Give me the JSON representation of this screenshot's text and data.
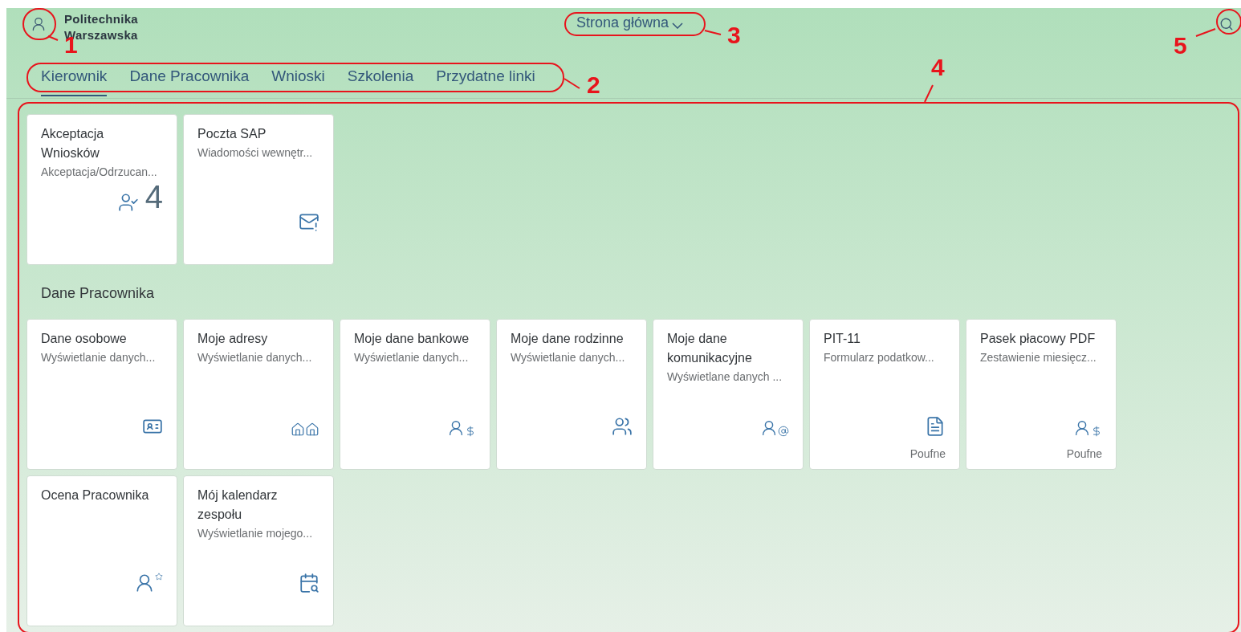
{
  "header": {
    "logo_lines": [
      "Politechnika",
      "Warszawska"
    ],
    "title": "Strona główna"
  },
  "tabs": [
    {
      "label": "Kierownik",
      "selected": true
    },
    {
      "label": "Dane Pracownika",
      "selected": false
    },
    {
      "label": "Wnioski",
      "selected": false
    },
    {
      "label": "Szkolenia",
      "selected": false
    },
    {
      "label": "Przydatne linki",
      "selected": false
    }
  ],
  "groups": [
    {
      "tiles": [
        {
          "title": "Akceptacja Wniosków",
          "subtitle": "Akceptacja/Odrzucan...",
          "count": "4"
        },
        {
          "title": "Poczta SAP",
          "subtitle": "Wiadomości wewnętr..."
        }
      ]
    },
    {
      "title": "Dane Pracownika",
      "tiles": [
        {
          "title": "Dane osobowe",
          "subtitle": "Wyświetlanie danych..."
        },
        {
          "title": "Moje adresy",
          "subtitle": "Wyświetlanie danych..."
        },
        {
          "title": "Moje dane bankowe",
          "subtitle": "Wyświetlanie danych..."
        },
        {
          "title": "Moje dane rodzinne",
          "subtitle": "Wyświetlanie danych..."
        },
        {
          "title": "Moje dane komunikacyjne",
          "subtitle": "Wyświetlane danych ..."
        },
        {
          "title": "PIT-11",
          "subtitle": "Formularz podatkow...",
          "footer": "Poufne"
        },
        {
          "title": "Pasek płacowy PDF",
          "subtitle": "Zestawienie miesięcz...",
          "footer": "Poufne"
        },
        {
          "title": "Ocena Pracownika"
        },
        {
          "title": "Mój kalendarz zespołu",
          "subtitle": "Wyświetlanie mojego..."
        }
      ]
    }
  ],
  "annotations": [
    {
      "label": "1"
    },
    {
      "label": "2"
    },
    {
      "label": "3"
    },
    {
      "label": "4"
    },
    {
      "label": "5"
    }
  ]
}
